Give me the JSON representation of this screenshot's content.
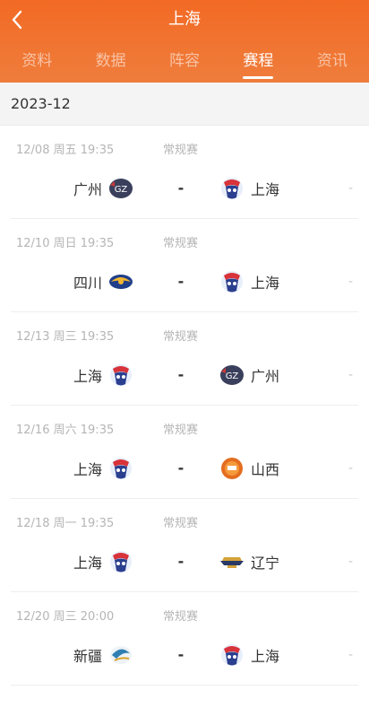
{
  "header": {
    "title": "上海",
    "back_icon": "chevron-left-icon"
  },
  "tabs": [
    {
      "label": "资料",
      "active": false
    },
    {
      "label": "数据",
      "active": false
    },
    {
      "label": "阵容",
      "active": false
    },
    {
      "label": "赛程",
      "active": true
    },
    {
      "label": "资讯",
      "active": false
    }
  ],
  "month": "2023-12",
  "colors": {
    "header": "#f26a24",
    "tab_indicator": "#ffffff"
  },
  "games": [
    {
      "date": "12/08",
      "weekday": "周五",
      "time": "19:35",
      "type": "常规赛",
      "home": {
        "name": "广州",
        "logo": "guangzhou-logo"
      },
      "score": "-",
      "away": {
        "name": "上海",
        "logo": "shanghai-logo"
      },
      "more": "-"
    },
    {
      "date": "12/10",
      "weekday": "周日",
      "time": "19:35",
      "type": "常规赛",
      "home": {
        "name": "四川",
        "logo": "sichuan-logo"
      },
      "score": "-",
      "away": {
        "name": "上海",
        "logo": "shanghai-logo"
      },
      "more": "-"
    },
    {
      "date": "12/13",
      "weekday": "周三",
      "time": "19:35",
      "type": "常规赛",
      "home": {
        "name": "上海",
        "logo": "shanghai-logo"
      },
      "score": "-",
      "away": {
        "name": "广州",
        "logo": "guangzhou-logo"
      },
      "more": "-"
    },
    {
      "date": "12/16",
      "weekday": "周六",
      "time": "19:35",
      "type": "常规赛",
      "home": {
        "name": "上海",
        "logo": "shanghai-logo"
      },
      "score": "-",
      "away": {
        "name": "山西",
        "logo": "shanxi-logo"
      },
      "more": "-"
    },
    {
      "date": "12/18",
      "weekday": "周一",
      "time": "19:35",
      "type": "常规赛",
      "home": {
        "name": "上海",
        "logo": "shanghai-logo"
      },
      "score": "-",
      "away": {
        "name": "辽宁",
        "logo": "liaoning-logo"
      },
      "more": "-"
    },
    {
      "date": "12/20",
      "weekday": "周三",
      "time": "20:00",
      "type": "常规赛",
      "home": {
        "name": "新疆",
        "logo": "xinjiang-logo"
      },
      "score": "-",
      "away": {
        "name": "上海",
        "logo": "shanghai-logo"
      },
      "more": "-"
    }
  ]
}
